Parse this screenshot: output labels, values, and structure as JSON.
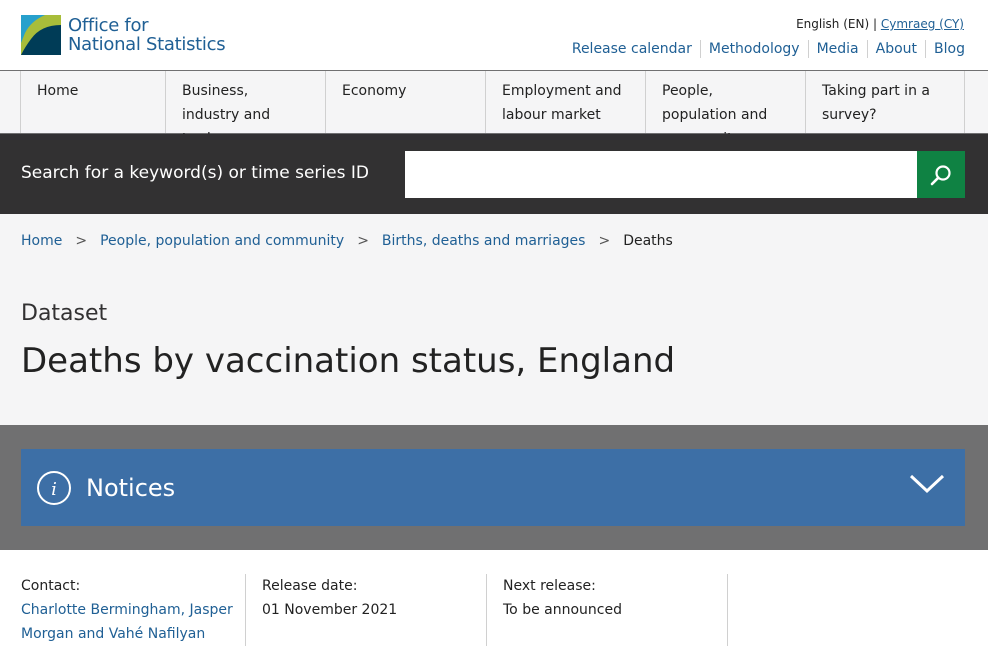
{
  "header": {
    "logo_line1": "Office for",
    "logo_line2": "National Statistics",
    "lang_current": "English (EN)",
    "lang_sep": "|",
    "lang_other": "Cymraeg (CY)",
    "links": [
      "Release calendar",
      "Methodology",
      "Media",
      "About",
      "Blog"
    ]
  },
  "nav": [
    "Home",
    "Business, industry and trade",
    "Economy",
    "Employment and labour market",
    "People, population and community",
    "Taking part in a survey?"
  ],
  "search": {
    "label": "Search for a keyword(s) or time series ID",
    "value": ""
  },
  "breadcrumb": {
    "items": [
      "Home",
      "People, population and community",
      "Births, deaths and marriages"
    ],
    "current": "Deaths",
    "separator": ">"
  },
  "page": {
    "type_label": "Dataset",
    "title": "Deaths by vaccination status, England"
  },
  "notice": {
    "label": "Notices"
  },
  "meta": {
    "contact_label": "Contact:",
    "contact_value": "Charlotte Bermingham, Jasper Morgan and Vahé Nafilyan",
    "release_label": "Release date:",
    "release_value": "01 November 2021",
    "next_label": "Next release:",
    "next_value": "To be announced"
  },
  "colors": {
    "brand_blue": "#206095",
    "search_green": "#0f8243",
    "notice_blue": "#3d6fa6",
    "dark_band": "#323132"
  }
}
